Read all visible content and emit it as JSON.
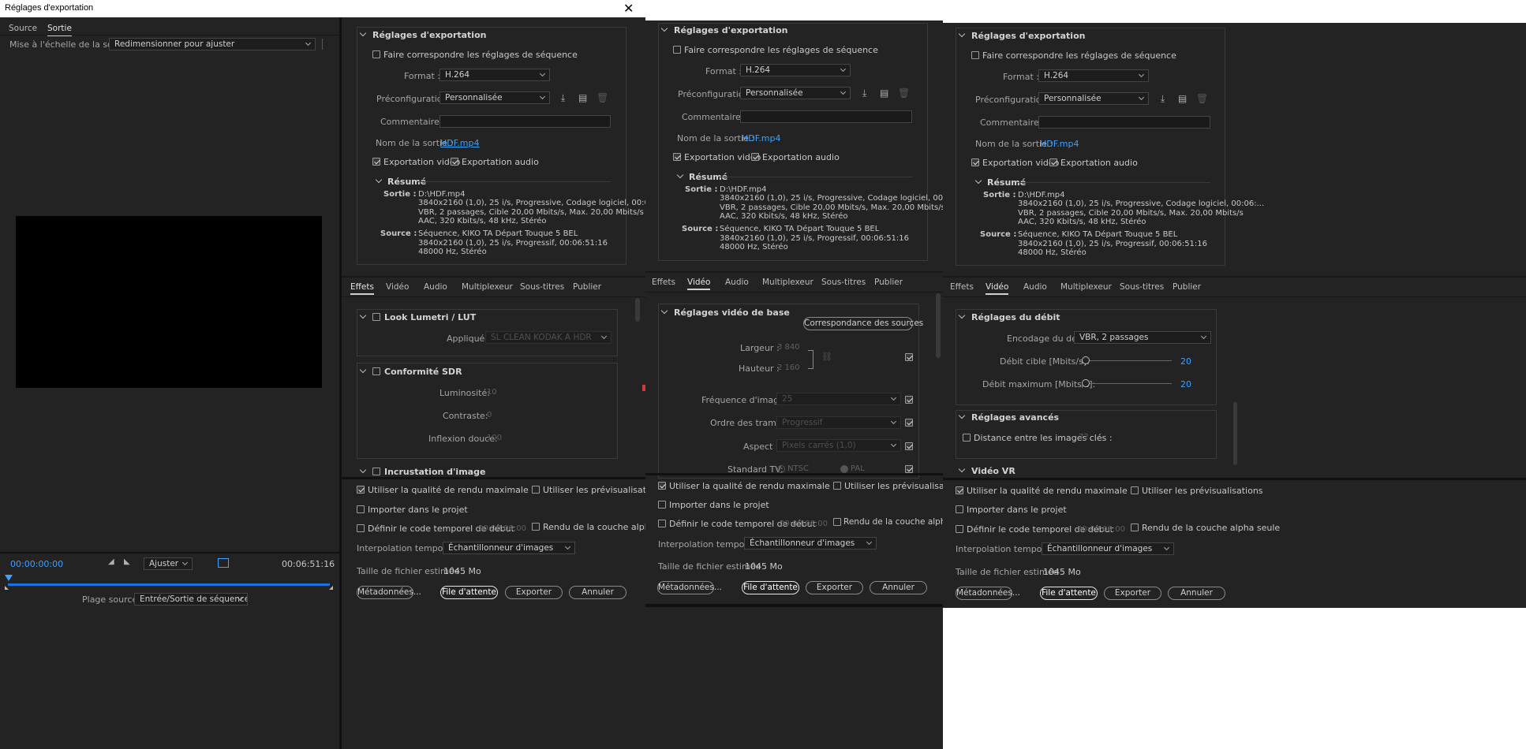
{
  "window": {
    "title": "Réglages d'exportation",
    "close_icon": "close-icon"
  },
  "left": {
    "tabs": [
      "Source",
      "Sortie"
    ],
    "active_tab": "Sortie",
    "scale_label": "Mise à l'échelle de la source :",
    "scale_value": "Redimensionner pour ajuster",
    "timecode_start": "00:00:00:00",
    "timecode_end": "00:06:51:16",
    "fit_value": "Ajuster",
    "range_label": "Plage source :",
    "range_value": "Entrée/Sortie de séquence"
  },
  "panels": [
    {
      "export": {
        "header": "Réglages d'exportation",
        "match_seq": "Faire correspondre les réglages de séquence",
        "format_label": "Format :",
        "format_value": "H.264",
        "preset_label": "Préconfiguration :",
        "preset_value": "Personnalisée",
        "comments_label": "Commentaires :",
        "output_label": "Nom de la sortie :",
        "output_value": "HDF.mp4",
        "export_video": "Exportation vidéo",
        "export_audio": "Exportation audio",
        "summary_header": "Résumé",
        "sortie_label": "Sortie :",
        "sortie_lines": [
          "D:\\HDF.mp4",
          "3840x2160 (1,0), 25 i/s, Progressive, Codage logiciel, 00:06:...",
          "VBR, 2 passages, Cible 20,00  Mbits/s, Max. 20,00  Mbits/s",
          "AAC, 320  Kbits/s, 48  kHz, Stéréo"
        ],
        "source_label": "Source :",
        "source_lines": [
          "Séquence, KIKO TA Départ Touque 5 BEL",
          "3840x2160 (1,0), 25  i/s, Progressif, 00:06:51:16",
          "48000 Hz, Stéréo"
        ]
      },
      "tabs": [
        "Effets",
        "Vidéo",
        "Audio",
        "Multiplexeur",
        "Sous-titres",
        "Publier"
      ],
      "active_tab": "Effets",
      "effects": {
        "lumetri": "Look Lumetri / LUT",
        "applied_label": "Appliqué :",
        "applied_value": "SL CLEAN KODAK A HDR",
        "sdr": "Conformité SDR",
        "lum_label": "Luminosité:",
        "lum_value": "10",
        "con_label": "Contraste:",
        "con_value": "0",
        "knee_label": "Inflexion douce:",
        "knee_value": "100",
        "overlay": "Incrustation d'image"
      },
      "bottom": {
        "max_quality": "Utiliser la qualité de rendu maximale",
        "previews": "Utiliser les prévisualisations",
        "import": "Importer dans le projet",
        "timecode": "Définir le code temporel de début",
        "timecode_value": "00:00:00:00",
        "alpha": "Rendu de la couche alpha seule",
        "interp_label": "Interpolation temporelle :",
        "interp_value": "Échantillonneur d'images",
        "size_label": "Taille de fichier estimée :",
        "size_value": "1045 Mo",
        "metadata": "Métadonnées...",
        "queue": "File d'attente",
        "export": "Exporter",
        "cancel": "Annuler"
      }
    },
    {
      "tabs": [
        "Effets",
        "Vidéo",
        "Audio",
        "Multiplexeur",
        "Sous-titres",
        "Publier"
      ],
      "active_tab": "Vidéo",
      "video": {
        "header": "Réglages vidéo de base",
        "match_sources": "Correspondance des sources",
        "width_label": "Largeur :",
        "width_value": "3 840",
        "height_label": "Hauteur :",
        "height_value": "2 160",
        "fps_label": "Fréquence d'images :",
        "fps_value": "25",
        "field_label": "Ordre des trames :",
        "field_value": "Progressif",
        "aspect_label": "Aspect :",
        "aspect_value": "Pixels carrés (1,0)",
        "tv_label": "Standard TV:",
        "ntsc": "NTSC",
        "pal": "PAL"
      }
    },
    {
      "tabs": [
        "Effets",
        "Vidéo",
        "Audio",
        "Multiplexeur",
        "Sous-titres",
        "Publier"
      ],
      "active_tab": "Vidéo",
      "bitrate": {
        "header": "Réglages du débit",
        "enc_label": "Encodage du débit:",
        "enc_value": "VBR, 2 passages",
        "target_label": "Débit cible [Mbits/s]:",
        "target_value": "20",
        "max_label": "Débit maximum [Mbits/s]:",
        "max_value": "20",
        "adv_header": "Réglages avancés",
        "keyframe": "Distance entre les images clés :",
        "keyframe_value": "72",
        "vr_header": "Vidéo VR"
      }
    }
  ],
  "colors": {
    "bg": "#232323",
    "accent": "#3ea0ff",
    "timeline": "#1473e6"
  }
}
